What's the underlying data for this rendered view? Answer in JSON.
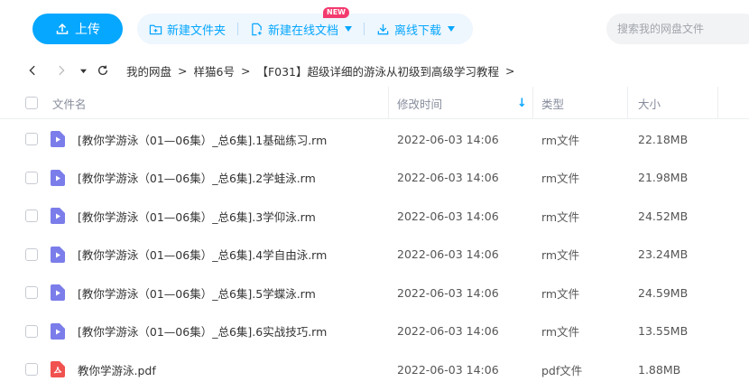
{
  "toolbar": {
    "upload_label": "上传",
    "new_folder_label": "新建文件夹",
    "new_online_doc_label": "新建在线文档",
    "new_badge": "NEW",
    "offline_download_label": "离线下载",
    "search_placeholder": "搜索我的网盘文件"
  },
  "breadcrumb": {
    "items": [
      "我的网盘",
      "样猫6号",
      "【F031】超级详细的游泳从初级到高级学习教程"
    ],
    "separator": ">"
  },
  "table": {
    "headers": {
      "name": "文件名",
      "modified": "修改时间",
      "type": "类型",
      "size": "大小"
    },
    "rows": [
      {
        "name": "[教你学游泳（01—06集）_总6集].1基础练习.rm",
        "modified": "2022-06-03 14:06",
        "type": "rm文件",
        "size": "22.18MB",
        "icon": "video-file-icon"
      },
      {
        "name": "[教你学游泳（01—06集）_总6集].2学蛙泳.rm",
        "modified": "2022-06-03 14:06",
        "type": "rm文件",
        "size": "21.98MB",
        "icon": "video-file-icon"
      },
      {
        "name": "[教你学游泳（01—06集）_总6集].3学仰泳.rm",
        "modified": "2022-06-03 14:06",
        "type": "rm文件",
        "size": "24.52MB",
        "icon": "video-file-icon"
      },
      {
        "name": "[教你学游泳（01—06集）_总6集].4学自由泳.rm",
        "modified": "2022-06-03 14:06",
        "type": "rm文件",
        "size": "23.24MB",
        "icon": "video-file-icon"
      },
      {
        "name": "[教你学游泳（01—06集）_总6集].5学蝶泳.rm",
        "modified": "2022-06-03 14:06",
        "type": "rm文件",
        "size": "24.59MB",
        "icon": "video-file-icon"
      },
      {
        "name": "[教你学游泳（01—06集）_总6集].6实战技巧.rm",
        "modified": "2022-06-03 14:06",
        "type": "rm文件",
        "size": "13.55MB",
        "icon": "video-file-icon"
      },
      {
        "name": "教你学游泳.pdf",
        "modified": "2022-06-03 14:06",
        "type": "pdf文件",
        "size": "1.88MB",
        "icon": "pdf-file-icon"
      }
    ]
  },
  "colors": {
    "accent": "#06a7ff",
    "video_icon": "#7b7dea",
    "pdf_icon": "#f0524f",
    "badge": "#f33a6e"
  }
}
